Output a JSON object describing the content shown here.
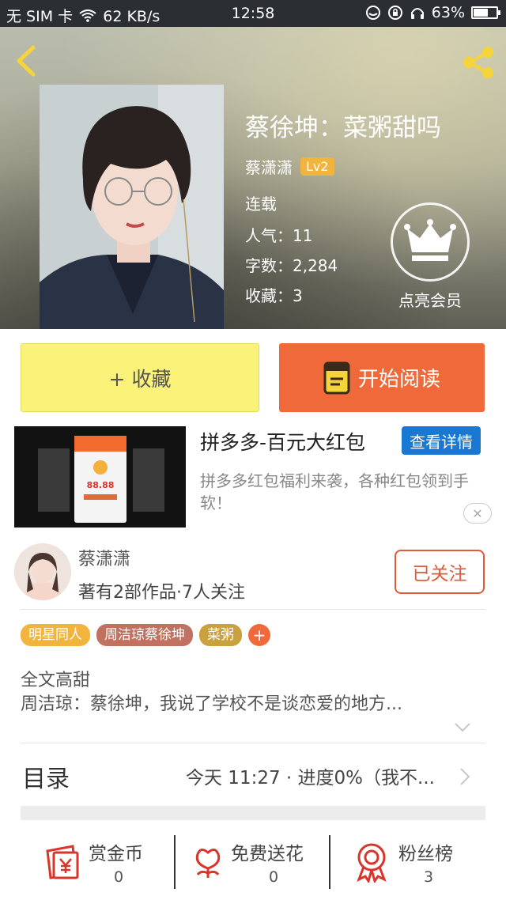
{
  "status_bar": {
    "carrier": "无 SIM 卡",
    "network_speed": "62 KB/s",
    "time": "12:58",
    "battery": "63%",
    "battery_level": 0.63
  },
  "book": {
    "title": "蔡徐坤：菜粥甜吗",
    "author": "蔡潇潇",
    "level": "Lv2",
    "status": "连载",
    "popularity": "人气：11",
    "word_count": "字数：2,284",
    "collections": "收藏：3",
    "member_label": "点亮会员"
  },
  "actions": {
    "collect_label": "+ 收藏",
    "read_label": "开始阅读"
  },
  "ad": {
    "title": "拼多多-百元大红包",
    "detail_label": "查看详情",
    "description": "拼多多红包福利来袭，各种红包领到手软！",
    "thumb_amount": "88.88",
    "close_symbol": "✕"
  },
  "author_card": {
    "name": "蔡潇潇",
    "meta": "著有2部作品·7人关注",
    "follow_label": "已关注"
  },
  "tags": [
    {
      "label": "明星同人",
      "color": "#f0b43f"
    },
    {
      "label": "周洁琼蔡徐坤",
      "color": "#c0715f"
    },
    {
      "label": "菜粥",
      "color": "#c9a23f"
    }
  ],
  "tag_add": "+",
  "summary": {
    "line1": "全文高甜",
    "line2": "周洁琼：蔡徐坤，我说了学校不是谈恋爱的地方..."
  },
  "toc": {
    "label": "目录",
    "meta": "今天 11:27 · 进度0%（我不..."
  },
  "bottom": [
    {
      "label": "赏金币",
      "count": "0",
      "icon": "reward-coin-icon"
    },
    {
      "label": "免费送花",
      "count": "0",
      "icon": "flower-icon"
    },
    {
      "label": "粉丝榜",
      "count": "3",
      "icon": "medal-icon"
    }
  ],
  "colors": {
    "accent_orange": "#f0693a",
    "collect_yellow": "#fbf27a",
    "ad_blue": "#1a77d2",
    "icon_red": "#d9352a"
  }
}
